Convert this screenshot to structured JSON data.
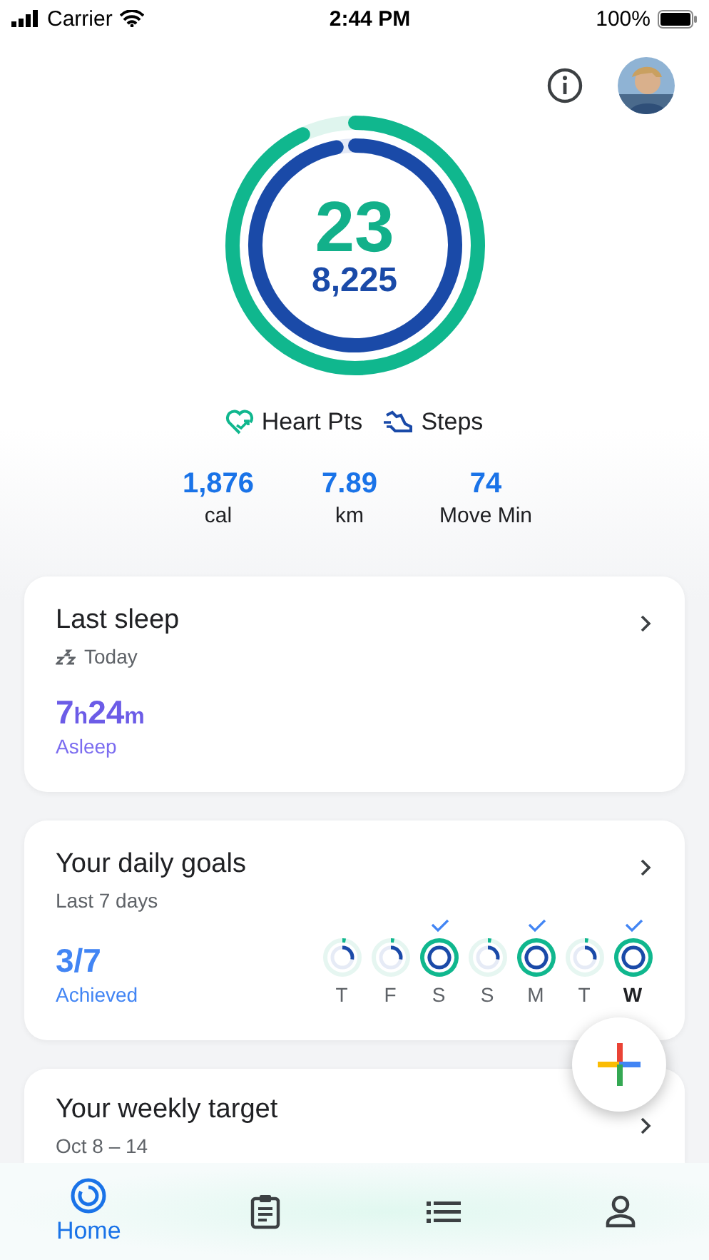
{
  "status_bar": {
    "carrier": "Carrier",
    "time": "2:44 PM",
    "battery": "100%"
  },
  "summary": {
    "heart_pts": {
      "value": "23"
    },
    "steps": {
      "value": "8,225"
    }
  },
  "legend": [
    {
      "label": "Heart Pts"
    },
    {
      "label": "Steps"
    }
  ],
  "stats": [
    {
      "value": "1,876",
      "label": "cal"
    },
    {
      "value": "7.89",
      "label": "km"
    },
    {
      "value": "74",
      "label": "Move Min"
    }
  ],
  "sleep_card": {
    "title": "Last sleep",
    "subtitle": "Today",
    "hours": "7",
    "hours_unit": "h",
    "minutes": "24",
    "minutes_unit": "m",
    "caption": "Asleep"
  },
  "goals_card": {
    "title": "Your daily goals",
    "subtitle": "Last 7 days",
    "value": "3/7",
    "caption": "Achieved",
    "days": [
      {
        "label": "T",
        "achieved": false,
        "today": false
      },
      {
        "label": "F",
        "achieved": false,
        "today": false
      },
      {
        "label": "S",
        "achieved": true,
        "today": false
      },
      {
        "label": "S",
        "achieved": false,
        "today": false
      },
      {
        "label": "M",
        "achieved": true,
        "today": false
      },
      {
        "label": "T",
        "achieved": false,
        "today": false
      },
      {
        "label": "W",
        "achieved": true,
        "today": true
      }
    ]
  },
  "weekly_card": {
    "title": "Your weekly target",
    "subtitle": "Oct 8 – 14"
  },
  "nav": [
    {
      "label": "Home",
      "selected": true
    },
    {
      "selected": false
    },
    {
      "selected": false
    },
    {
      "selected": false
    }
  ]
}
